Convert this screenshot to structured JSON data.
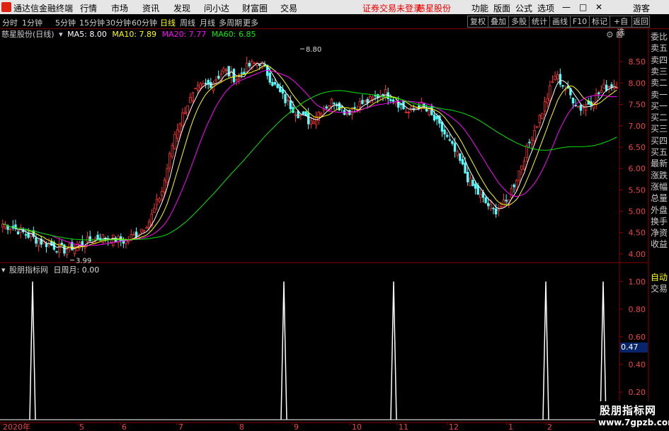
{
  "menubar": {
    "app_title": "通达信金融终端",
    "items": [
      "行情",
      "市场",
      "资讯",
      "发现",
      "问小达",
      "财富圈",
      "交易"
    ],
    "notice": "证券交易未登录",
    "stock": "慈星股份",
    "right_items": [
      "功能",
      "版面",
      "公式",
      "选项"
    ],
    "guest": "游客",
    "win_controls": [
      "—",
      "□",
      "✕"
    ]
  },
  "toolbar": {
    "periods": [
      "分时",
      "1分钟",
      "5分钟",
      "15分钟",
      "30分钟",
      "60分钟",
      "日线",
      "周线",
      "月线",
      "多周期",
      "更多"
    ],
    "active": "日线",
    "buttons": [
      "复权",
      "叠加",
      "多股",
      "统计",
      "画线",
      "F10",
      "标记",
      "+自选",
      "返回"
    ]
  },
  "kline_info": {
    "title": "慈星股份(日线)",
    "ma5": "MA5: 8.00",
    "ma10": "MA10: 7.89",
    "ma20": "MA20: 7.77",
    "ma60": "MA60: 6.85"
  },
  "indicator_info": {
    "name": "股朋指标网",
    "value": "日周月: 0.00"
  },
  "sidebar_items": [
    "委比",
    "卖五",
    "卖四",
    "卖三",
    "卖二",
    "卖一",
    "买一",
    "买二",
    "买三",
    "买四",
    "买五",
    "最新",
    "涨跌",
    "涨幅",
    "总量",
    "外盘",
    "换手",
    "净资",
    "收益"
  ],
  "sidebar_bottom": [
    "自动",
    "交易"
  ],
  "watermark": {
    "line1": "股朋指标网",
    "line2": "www.7gpzb.com"
  },
  "current_value": "0.47",
  "colors": {
    "up": "#ff3232",
    "down": "#54fcfc",
    "ma5": "#ffffff",
    "ma10": "#ffff00",
    "ma20": "#ff00ff",
    "ma60": "#00e600",
    "grid": "#8b0000"
  },
  "chart_data": {
    "type": "candlestick",
    "price_axis": {
      "ticks": [
        "8.50",
        "8.00",
        "7.50",
        "7.00",
        "6.50",
        "6.00",
        "5.50",
        "5.00",
        "4.50",
        "4.00"
      ],
      "range": [
        3.85,
        8.95
      ]
    },
    "indicator_axis": {
      "ticks": [
        "1.00",
        "0.80",
        "0.60",
        "0.40",
        "0.20"
      ],
      "range": [
        0,
        1.05
      ]
    },
    "x_labels": [
      "2020年",
      "5",
      "6",
      "7",
      "8",
      "9",
      "10",
      "11",
      "12",
      "1",
      "2"
    ],
    "annotations": [
      {
        "text": "8.80",
        "value": 8.8
      },
      {
        "text": "3.99",
        "value": 3.99
      }
    ],
    "key_closes": [
      4.7,
      4.6,
      4.45,
      4.3,
      4.2,
      4.1,
      4.2,
      4.3,
      4.4,
      4.35,
      4.3,
      4.5,
      4.8,
      5.5,
      6.8,
      7.5,
      7.9,
      8.0,
      8.3,
      8.1,
      8.4,
      8.5,
      8.0,
      7.6,
      7.3,
      7.1,
      7.4,
      7.6,
      7.3,
      7.5,
      7.6,
      7.8,
      7.6,
      7.3,
      7.5,
      7.2,
      6.8,
      6.3,
      5.7,
      5.3,
      5.0,
      5.2,
      5.9,
      6.7,
      7.4,
      8.2,
      7.8,
      7.4,
      7.6,
      7.9,
      8.0
    ],
    "indicator_spikes": [
      {
        "value": 1.0
      },
      {
        "value": 1.0
      },
      {
        "value": 1.0
      },
      {
        "value": 1.0
      },
      {
        "value": 1.0
      }
    ],
    "indicator_last": 0.47
  }
}
